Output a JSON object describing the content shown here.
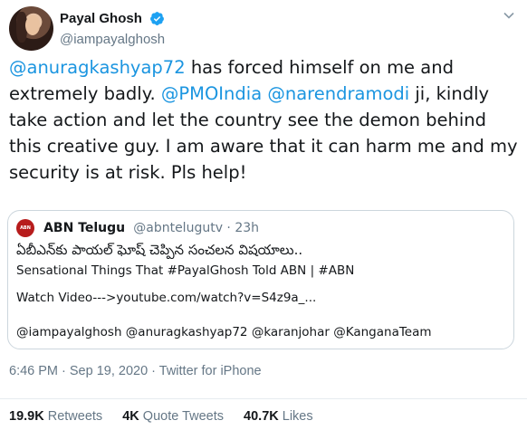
{
  "author": {
    "display_name": "Payal Ghosh",
    "handle": "@iampayalghosh"
  },
  "tweet": {
    "mention_1": "@anuragkashyap72",
    "text_1": " has forced himself on me and extremely badly. ",
    "mention_2": "@PMOIndia",
    "text_2": " ",
    "mention_3": "@narendramodi",
    "text_3": " ji, kindly take action and let the country see the demon behind this creative guy. I am aware that it can harm me and my security is at risk. Pls help!"
  },
  "quote": {
    "logo_text": "ABN",
    "name": "ABN Telugu",
    "handle_time": "@abntelugutv · 23h",
    "line_1": "ఏబీఎన్‌కు పాయల్ ఘోష్ చెప్పిన సంచలన విషయాలు..",
    "line_2": "Sensational Things That #PayalGhosh Told ABN | #ABN",
    "line_3": "Watch Video--->youtube.com/watch?v=S4z9a_...",
    "line_4": "@iampayalghosh @anuragkashyap72 @karanjohar @KanganaTeam"
  },
  "meta": {
    "timestamp": "6:46 PM · Sep 19, 2020 · Twitter for iPhone"
  },
  "stats": {
    "retweets_count": "19.9K",
    "retweets_label": "Retweets",
    "quotes_count": "4K",
    "quotes_label": "Quote Tweets",
    "likes_count": "40.7K",
    "likes_label": "Likes"
  },
  "colors": {
    "link": "#1b95e0",
    "secondary_text": "#657786",
    "verified_badge": "#1da1f2"
  },
  "icons": {
    "verified": "verified-badge-icon",
    "more": "chevron-down-icon"
  }
}
